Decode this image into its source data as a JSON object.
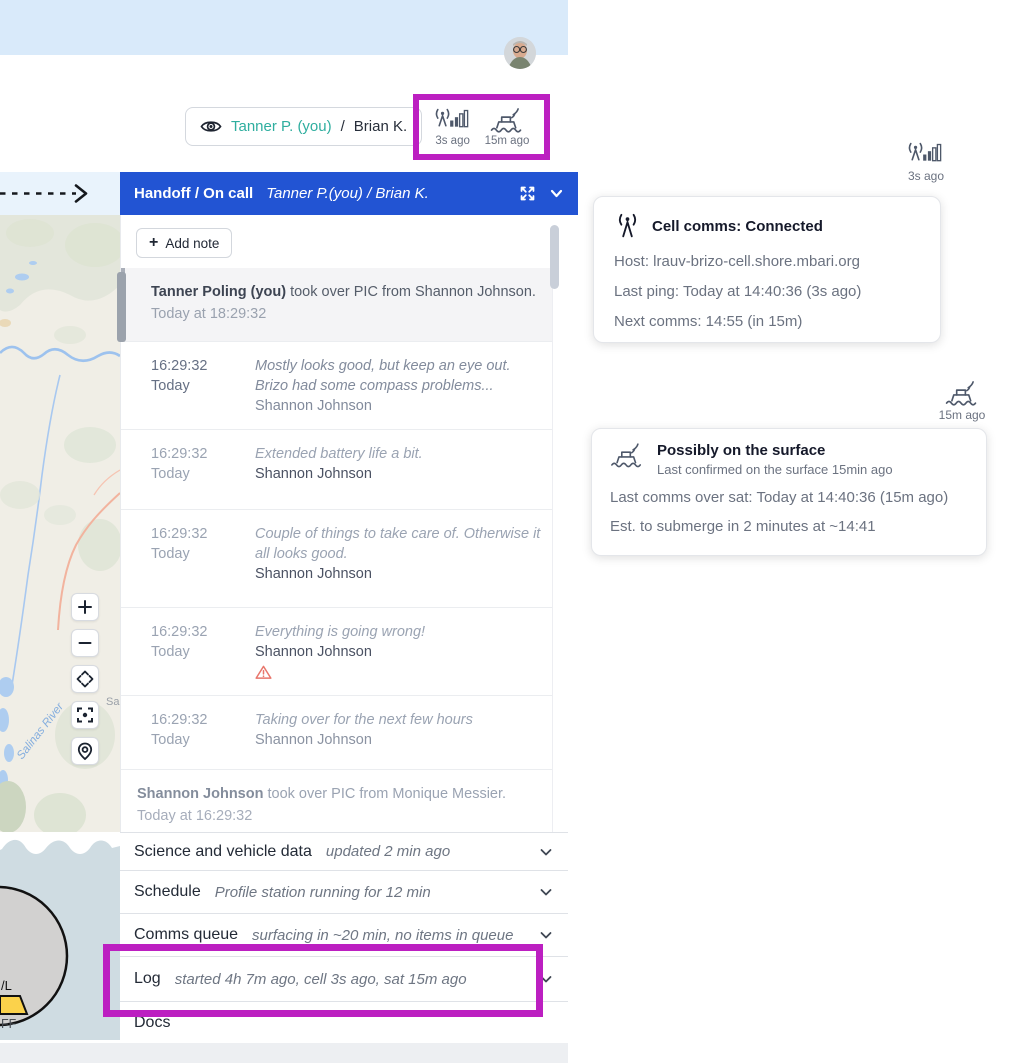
{
  "observer_pill": {
    "observer": "Tanner P. (you)",
    "divider": "/",
    "partner": "Brian K."
  },
  "comms_status": {
    "cell_ago": "3s ago",
    "sat_ago": "15m ago"
  },
  "handoff_bar": {
    "title": "Handoff / On call",
    "names": "Tanner P.(you) / Brian K."
  },
  "log_panel": {
    "add_note_plus": "+",
    "add_note_label": "Add note",
    "entries": [
      {
        "kind": "handoff",
        "name": "Tanner Poling (you)",
        "text": " took over PIC from Shannon Johnson.",
        "time": "Today at 18:29:32"
      },
      {
        "kind": "note",
        "time": "16:29:32",
        "day": "Today",
        "message": "Mostly looks good, but keep an eye out. Brizo had some compass problems...",
        "author": "Shannon Johnson"
      },
      {
        "kind": "note",
        "time": "16:29:32",
        "day": "Today",
        "message": "Extended battery life a bit.",
        "author": "Shannon Johnson"
      },
      {
        "kind": "note",
        "time": "16:29:32",
        "day": "Today",
        "message": "Couple of things to take care of. Otherwise it all looks good.",
        "author": "Shannon Johnson"
      },
      {
        "kind": "note",
        "time": "16:29:32",
        "day": "Today",
        "message": "Everything is going wrong!",
        "author": "Shannon Johnson",
        "warning": true
      },
      {
        "kind": "note",
        "time": "16:29:32",
        "day": "Today",
        "message": "Taking over for the next few hours",
        "author": "Shannon Johnson"
      },
      {
        "kind": "handoff",
        "name": "Shannon Johnson",
        "text": " took over PIC from Monique Messier.",
        "time": "Today at 16:29:32"
      }
    ]
  },
  "accordions": [
    {
      "title": "Science and vehicle data",
      "subtitle": "updated 2 min ago"
    },
    {
      "title": "Schedule",
      "subtitle": "Profile station running for 12 min"
    },
    {
      "title": "Comms queue",
      "subtitle": "surfacing in ~20 min, no items in queue"
    },
    {
      "title": "Log",
      "subtitle": "started 4h 7m ago, cell 3s ago, sat 15m ago"
    },
    {
      "title": "Docs",
      "subtitle": ""
    }
  ],
  "cell_tooltip": {
    "ago": "3s ago",
    "title": "Cell comms: Connected",
    "host": "Host: lrauv-brizo-cell.shore.mbari.org",
    "last_ping": "Last ping: Today at 14:40:36 (3s ago)",
    "next_comms": "Next comms: 14:55 (in 15m)"
  },
  "sat_tooltip": {
    "ago": "15m ago",
    "title": "Possibly on the surface",
    "subtitle": "Last confirmed on the surface 15min ago",
    "last_comms": "Last comms over sat: Today at 14:40:36 (15m ago)",
    "est": "Est. to submerge in 2 minutes at ~14:41"
  },
  "map": {
    "river_label": "Salinas River",
    "city_label_partial": "Sa",
    "vehicle_label_partial_1": "/L",
    "vehicle_label_partial_2": "FF"
  },
  "colors": {
    "accent_blue": "#2254d3",
    "highlight_magenta": "#bc1fc1",
    "header_blue_bg": "#d9eafa",
    "teal_name": "#2fae9f"
  }
}
